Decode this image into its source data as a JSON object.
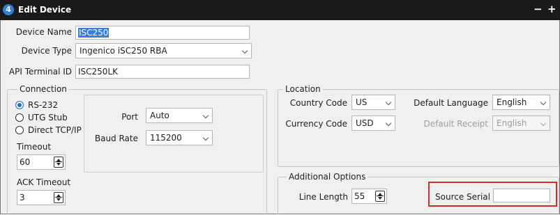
{
  "window": {
    "badge": "4",
    "title": "Edit Device",
    "min_glyph": "−",
    "max_glyph": "+"
  },
  "fields": {
    "device_name": {
      "label": "Device Name",
      "value": "ISC250"
    },
    "device_type": {
      "label": "Device Type",
      "value": "Ingenico iSC250 RBA"
    },
    "api_terminal_id": {
      "label": "API Terminal ID",
      "value": "ISC250LK"
    }
  },
  "connection": {
    "legend": "Connection",
    "radios": [
      {
        "label": "RS-232",
        "checked": true
      },
      {
        "label": "UTG Stub",
        "checked": false
      },
      {
        "label": "Direct TCP/IP",
        "checked": false
      }
    ],
    "timeout": {
      "label": "Timeout",
      "value": "60"
    },
    "ack_timeout": {
      "label": "ACK Timeout",
      "value": "3"
    },
    "port": {
      "label": "Port",
      "value": "Auto"
    },
    "baud_rate": {
      "label": "Baud Rate",
      "value": "115200"
    }
  },
  "location": {
    "legend": "Location",
    "country_code": {
      "label": "Country Code",
      "value": "US"
    },
    "currency_code": {
      "label": "Currency Code",
      "value": "USD"
    },
    "default_language": {
      "label": "Default Language",
      "value": "English"
    },
    "default_receipt": {
      "label": "Default Receipt",
      "value": "English",
      "disabled": true
    }
  },
  "additional": {
    "legend": "Additional Options",
    "line_length": {
      "label": "Line Length",
      "value": "55"
    },
    "source_serial": {
      "label": "Source Serial",
      "value": ""
    }
  },
  "colors": {
    "titlebar": "#1a1a1a",
    "accent": "#2f7fd6",
    "highlight_box": "#d42b2b",
    "panel": "#f0f0f0"
  }
}
